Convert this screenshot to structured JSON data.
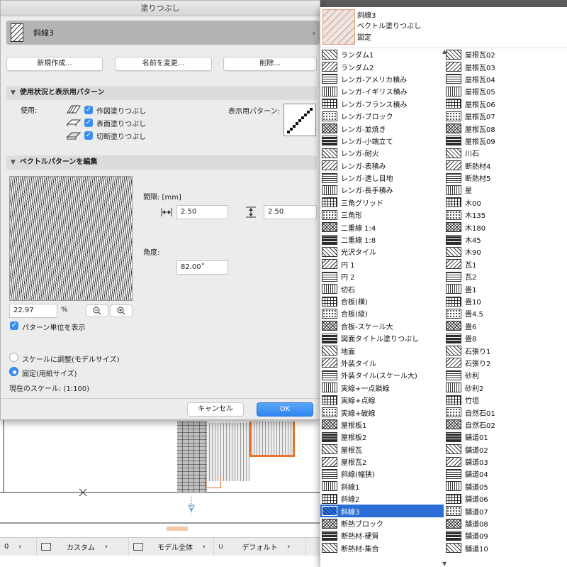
{
  "dialog": {
    "title": "塗りつぶし",
    "current_pattern": "斜線3",
    "buttons": {
      "new": "新規作成...",
      "rename": "名前を変更...",
      "delete": "削除..."
    },
    "usage_section": {
      "header": "使用状況と表示用パターン",
      "use_label": "使用:",
      "checks": [
        {
          "label": "作図塗りつぶし",
          "checked": true
        },
        {
          "label": "表面塗りつぶし",
          "checked": true
        },
        {
          "label": "切断塗りつぶし",
          "checked": true
        }
      ],
      "display_pattern_label": "表示用パターン:"
    },
    "vector_section": {
      "header": "ベクトルパターンを編集",
      "spacing_label": "間隔: [mm]",
      "spacing_h": "2.50",
      "spacing_v": "2.50",
      "angle_label": "角度:",
      "angle_value": "82.00˚",
      "zoom_value": "22.97",
      "zoom_unit": "%",
      "show_unit_label": "パターン単位を表示",
      "show_unit_checked": true
    },
    "scale": {
      "option_scale": "スケールに調整(モデルサイズ)",
      "option_fixed": "固定(用紙サイズ)",
      "selected": "fixed",
      "current_scale": "現在のスケール: (1:100)"
    },
    "footer": {
      "cancel": "キャンセル",
      "ok": "OK"
    }
  },
  "popup": {
    "header": {
      "name": "斜線3",
      "type": "ベクトル塗りつぶし",
      "mode": "固定"
    },
    "left_column": [
      "ランダム1",
      "ランダム2",
      "レンガ-アメリカ積み",
      "レンガ-イギリス積み",
      "レンガ-フランス積み",
      "レンガ-ブロック",
      "レンガ-並焼き",
      "レンガ-小端立て",
      "レンガ-耐火",
      "レンガ-表積み",
      "レンガ-透し目地",
      "レンガ-長手積み",
      "三角グリッド",
      "三角形",
      "二重線 1:4",
      "二重線 1:8",
      "光沢タイル",
      "円 1",
      "円 2",
      "切石",
      "合板(横)",
      "合板(縦)",
      "合板-スケール大",
      "図面タイトル塗りつぶし",
      "地面",
      "外装タイル",
      "外装タイル(スケール大)",
      "実線+一点鎖線",
      "実線+点線",
      "実線+破線",
      "屋根板1",
      "屋根板2",
      "屋根瓦",
      "屋根瓦2",
      "斜線(幅狭)",
      "斜線1",
      "斜線2",
      "斜線3",
      "断熱ブロック",
      "断熱材-硬質",
      "断熱材-集合"
    ],
    "right_column": [
      "屋根瓦02",
      "屋根瓦03",
      "屋根瓦04",
      "屋根瓦05",
      "屋根瓦06",
      "屋根瓦07",
      "屋根瓦08",
      "屋根瓦09",
      "川石",
      "断熱材4",
      "断熱材5",
      "星",
      "木00",
      "木135",
      "木180",
      "木45",
      "木90",
      "瓦1",
      "瓦2",
      "畳1",
      "畳10",
      "畳4.5",
      "畳6",
      "畳8",
      "石張り1",
      "石張り2",
      "砂利",
      "砂利2",
      "竹垣",
      "自然石01",
      "自然石02",
      "舗道01",
      "舗道02",
      "舗道03",
      "舗道04",
      "舗道05",
      "舗道06",
      "舗道07",
      "舗道08",
      "舗道09",
      "舗道10"
    ],
    "selected": "斜線3"
  },
  "statusbar": {
    "items": [
      "0",
      "カスタム",
      "モデル全体",
      "デフォルト"
    ]
  },
  "colors": {
    "accent": "#3b8ef0",
    "selection": "#2c6ed6",
    "dialog_bg": "#ececec"
  }
}
